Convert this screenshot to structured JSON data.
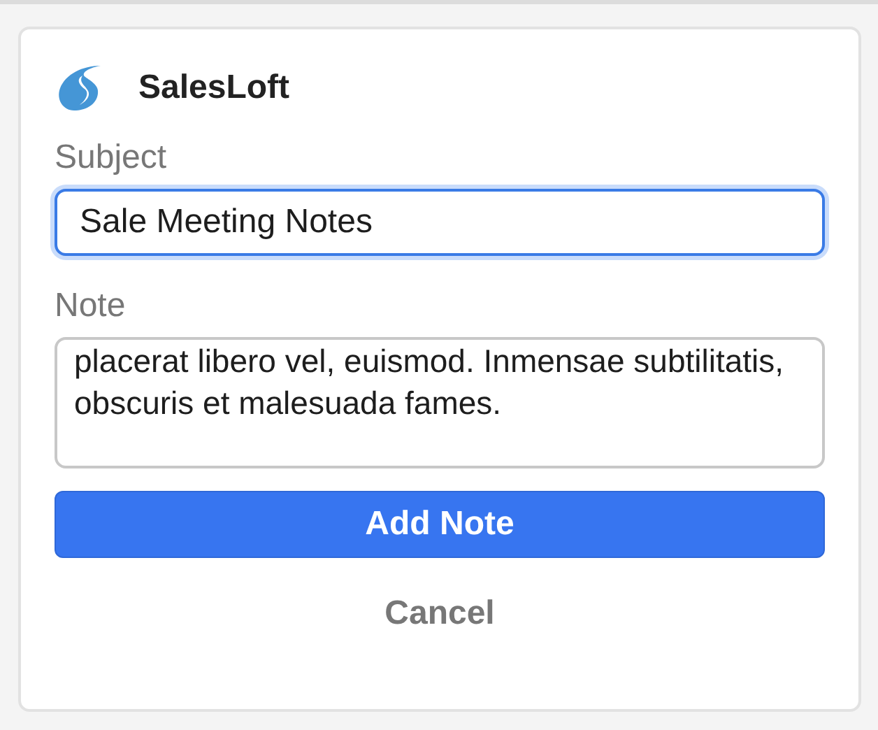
{
  "brand": {
    "name": "SalesLoft"
  },
  "subject": {
    "label": "Subject",
    "value": "Sale Meeting Notes",
    "focused": true
  },
  "note": {
    "label": "Note",
    "value": "placerat libero vel, euismod. Inmensae subtilitatis, obscuris et malesuada fames.",
    "focused": false
  },
  "buttons": [
    {
      "kind": "primary",
      "label": "Add Note"
    },
    {
      "kind": "link",
      "label": "Cancel"
    }
  ]
}
